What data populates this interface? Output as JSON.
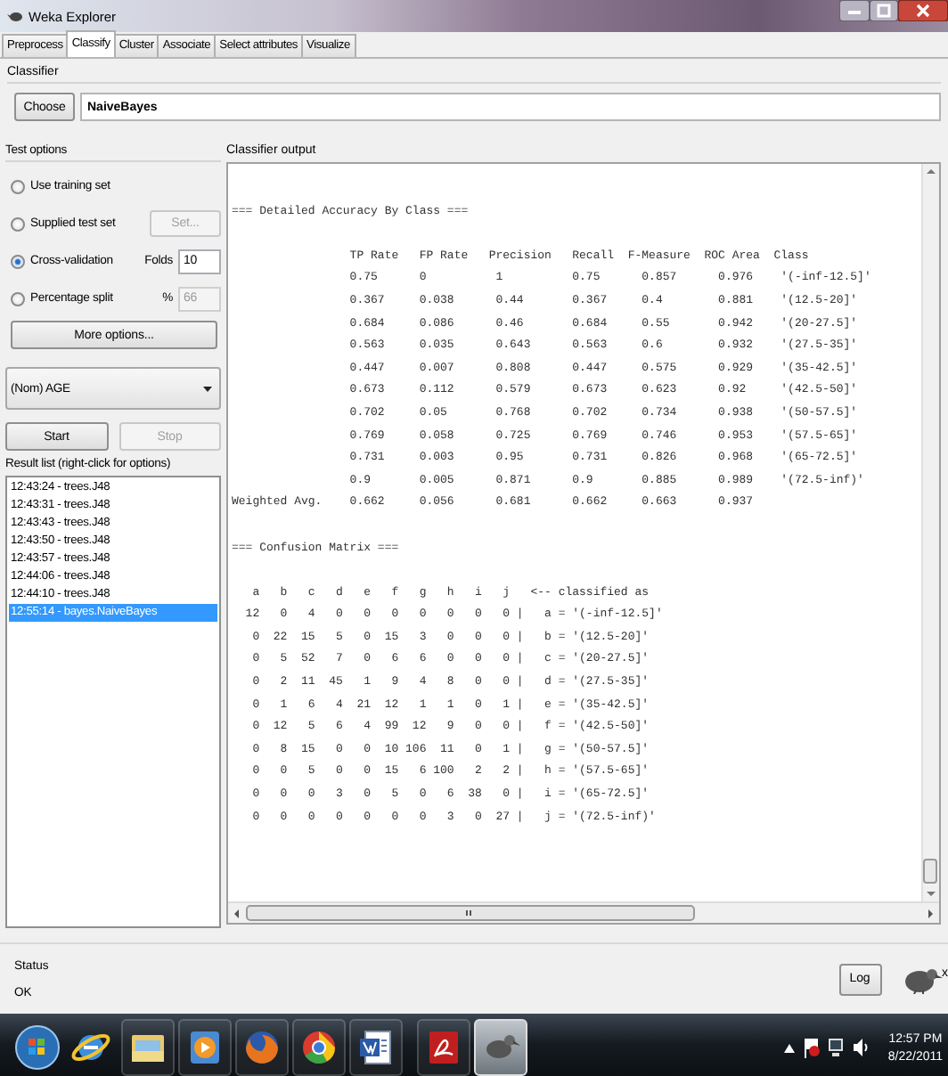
{
  "window": {
    "title": "Weka Explorer"
  },
  "tabs": [
    {
      "label": "Preprocess",
      "selected": false
    },
    {
      "label": "Classify",
      "selected": true
    },
    {
      "label": "Cluster",
      "selected": false
    },
    {
      "label": "Associate",
      "selected": false
    },
    {
      "label": "Select attributes",
      "selected": false
    },
    {
      "label": "Visualize",
      "selected": false
    }
  ],
  "classifier": {
    "label": "Classifier",
    "choose_button": "Choose",
    "name": "NaiveBayes"
  },
  "test_options": {
    "label": "Test options",
    "options": [
      {
        "label": "Use training set",
        "selected": false
      },
      {
        "label": "Supplied test set",
        "selected": false,
        "button": {
          "label": "Set...",
          "disabled": true
        }
      },
      {
        "label": "Cross-validation",
        "selected": true,
        "field": {
          "label": "Folds",
          "value": "10",
          "disabled": false
        }
      },
      {
        "label": "Percentage split",
        "selected": false,
        "field": {
          "label": "%",
          "value": "66",
          "disabled": true
        }
      }
    ],
    "more_button": "More options..."
  },
  "class_dropdown": {
    "value": "(Nom) AGE"
  },
  "run_buttons": [
    {
      "label": "Start",
      "disabled": false
    },
    {
      "label": "Stop",
      "disabled": true
    }
  ],
  "result_list": {
    "label": "Result list (right-click for options)",
    "items": [
      {
        "label": "12:43:24 - trees.J48",
        "selected": false
      },
      {
        "label": "12:43:31 - trees.J48",
        "selected": false
      },
      {
        "label": "12:43:43 - trees.J48",
        "selected": false
      },
      {
        "label": "12:43:50 - trees.J48",
        "selected": false
      },
      {
        "label": "12:43:57 - trees.J48",
        "selected": false
      },
      {
        "label": "12:44:06 - trees.J48",
        "selected": false
      },
      {
        "label": "12:44:10 - trees.J48",
        "selected": false
      },
      {
        "label": "12:55:14 - bayes.NaiveBayes",
        "selected": true
      }
    ]
  },
  "output": {
    "label": "Classifier output",
    "accuracy": {
      "title": "=== Detailed Accuracy By Class ===",
      "columns": [
        "TP Rate",
        "FP Rate",
        "Precision",
        "Recall",
        "F-Measure",
        "ROC Area",
        "Class"
      ],
      "rows": [
        {
          "values": [
            "0.75",
            "0",
            "1",
            "0.75",
            "0.857",
            "0.976"
          ],
          "class": "'(-inf-12.5]'"
        },
        {
          "values": [
            "0.367",
            "0.038",
            "0.44",
            "0.367",
            "0.4",
            "0.881"
          ],
          "class": "'(12.5-20]'"
        },
        {
          "values": [
            "0.684",
            "0.086",
            "0.46",
            "0.684",
            "0.55",
            "0.942"
          ],
          "class": "'(20-27.5]'"
        },
        {
          "values": [
            "0.563",
            "0.035",
            "0.643",
            "0.563",
            "0.6",
            "0.932"
          ],
          "class": "'(27.5-35]'"
        },
        {
          "values": [
            "0.447",
            "0.007",
            "0.808",
            "0.447",
            "0.575",
            "0.929"
          ],
          "class": "'(35-42.5]'"
        },
        {
          "values": [
            "0.673",
            "0.112",
            "0.579",
            "0.673",
            "0.623",
            "0.92"
          ],
          "class": "'(42.5-50]'"
        },
        {
          "values": [
            "0.702",
            "0.05",
            "0.768",
            "0.702",
            "0.734",
            "0.938"
          ],
          "class": "'(50-57.5]'"
        },
        {
          "values": [
            "0.769",
            "0.058",
            "0.725",
            "0.769",
            "0.746",
            "0.953"
          ],
          "class": "'(57.5-65]'"
        },
        {
          "values": [
            "0.731",
            "0.003",
            "0.95",
            "0.731",
            "0.826",
            "0.968"
          ],
          "class": "'(65-72.5]'"
        },
        {
          "values": [
            "0.9",
            "0.005",
            "0.871",
            "0.9",
            "0.885",
            "0.989"
          ],
          "class": "'(72.5-inf)'"
        }
      ],
      "weighted": {
        "label": "Weighted Avg.",
        "values": [
          "0.662",
          "0.056",
          "0.681",
          "0.662",
          "0.663",
          "0.937"
        ]
      }
    },
    "matrix": {
      "title": "=== Confusion Matrix ===",
      "columns": [
        "a",
        "b",
        "c",
        "d",
        "e",
        "f",
        "g",
        "h",
        "i",
        "j"
      ],
      "header_suffix": "<-- classified as",
      "separator": "|",
      "rows": [
        {
          "counts": [
            "12",
            "0",
            "4",
            "0",
            "0",
            "0",
            "0",
            "0",
            "0",
            "0"
          ],
          "label": "a = '(-inf-12.5]'"
        },
        {
          "counts": [
            "0",
            "22",
            "15",
            "5",
            "0",
            "15",
            "3",
            "0",
            "0",
            "0"
          ],
          "label": "b = '(12.5-20]'"
        },
        {
          "counts": [
            "0",
            "5",
            "52",
            "7",
            "0",
            "6",
            "6",
            "0",
            "0",
            "0"
          ],
          "label": "c = '(20-27.5]'"
        },
        {
          "counts": [
            "0",
            "2",
            "11",
            "45",
            "1",
            "9",
            "4",
            "8",
            "0",
            "0"
          ],
          "label": "d = '(27.5-35]'"
        },
        {
          "counts": [
            "0",
            "1",
            "6",
            "4",
            "21",
            "12",
            "1",
            "1",
            "0",
            "1"
          ],
          "label": "e = '(35-42.5]'"
        },
        {
          "counts": [
            "0",
            "12",
            "5",
            "6",
            "4",
            "99",
            "12",
            "9",
            "0",
            "0"
          ],
          "label": "f = '(42.5-50]'"
        },
        {
          "counts": [
            "0",
            "8",
            "15",
            "0",
            "0",
            "10",
            "106",
            "11",
            "0",
            "1"
          ],
          "label": "g = '(50-57.5]'"
        },
        {
          "counts": [
            "0",
            "0",
            "5",
            "0",
            "0",
            "15",
            "6",
            "100",
            "2",
            "2"
          ],
          "label": "h = '(57.5-65]'"
        },
        {
          "counts": [
            "0",
            "0",
            "0",
            "3",
            "0",
            "5",
            "0",
            "6",
            "38",
            "0"
          ],
          "label": "i = '(65-72.5]'"
        },
        {
          "counts": [
            "0",
            "0",
            "0",
            "0",
            "0",
            "0",
            "0",
            "3",
            "0",
            "27"
          ],
          "label": "j = '(72.5-inf)'"
        }
      ]
    }
  },
  "status": {
    "label": "Status",
    "text": "OK",
    "log_button": "Log",
    "count": "x"
  },
  "taskbar": {
    "apps": [
      {
        "kind": "ie",
        "active": false
      },
      {
        "kind": "folder",
        "active": false
      },
      {
        "kind": "media",
        "active": false
      },
      {
        "kind": "firefox",
        "active": false
      },
      {
        "kind": "chrome",
        "active": false
      },
      {
        "kind": "word",
        "active": false
      },
      {
        "kind": "pdf",
        "active": false
      },
      {
        "kind": "weka",
        "active": true
      }
    ],
    "time": "12:57 PM",
    "date": "8/22/2011"
  }
}
